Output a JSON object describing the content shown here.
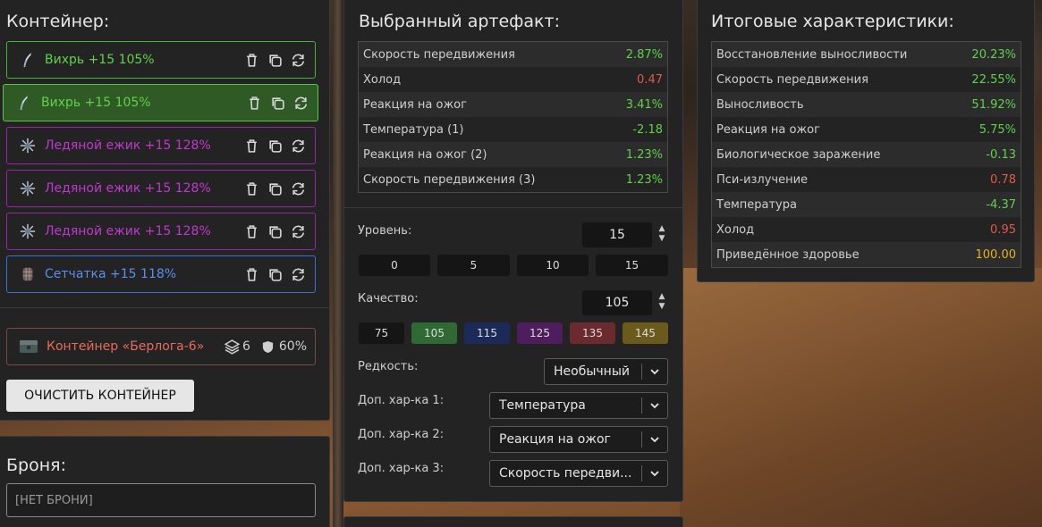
{
  "container": {
    "title": "Контейнер:",
    "items": [
      {
        "name": "Вихрь +15 105%",
        "icon": "feather-icon",
        "color": "green"
      },
      {
        "name": "Вихрь +15 105%",
        "icon": "feather-icon",
        "color": "green-selected"
      },
      {
        "name": "Ледяной ежик +15 128%",
        "icon": "ice-crystal-icon",
        "color": "purple"
      },
      {
        "name": "Ледяной ежик +15 128%",
        "icon": "ice-crystal-icon",
        "color": "purple"
      },
      {
        "name": "Ледяной ежик +15 128%",
        "icon": "ice-crystal-icon",
        "color": "purple"
      },
      {
        "name": "Сетчатка +15 118%",
        "icon": "mesh-artifact-icon",
        "color": "blue"
      }
    ],
    "box": {
      "name": "Контейнер «Берлога-6»",
      "slots": "6",
      "protection": "60%"
    },
    "clear_label": "ОЧИСТИТЬ КОНТЕЙНЕР"
  },
  "armor": {
    "title": "Броня:",
    "value": "[НЕТ БРОНИ]"
  },
  "artifact": {
    "title": "Выбранный артефакт:",
    "stats": [
      {
        "label": "Скорость передвижения",
        "value": "2.87%",
        "color": "#5fd24a"
      },
      {
        "label": "Холод",
        "value": "0.47",
        "color": "#e05a4a"
      },
      {
        "label": "Реакция на ожог",
        "value": "3.41%",
        "color": "#5fd24a"
      },
      {
        "label": "Температура (1)",
        "value": "-2.18",
        "color": "#5fd24a"
      },
      {
        "label": "Реакция на ожог (2)",
        "value": "1.23%",
        "color": "#5fd24a"
      },
      {
        "label": "Скорость передвижения (3)",
        "value": "1.23%",
        "color": "#5fd24a"
      }
    ],
    "level": {
      "label": "Уровень:",
      "value": "15",
      "presets": [
        "0",
        "5",
        "10",
        "15"
      ]
    },
    "quality": {
      "label": "Качество:",
      "value": "105",
      "presets": [
        "75",
        "105",
        "115",
        "125",
        "135",
        "145"
      ]
    },
    "rarity": {
      "label": "Редкость:",
      "value": "Необычный"
    },
    "extra1": {
      "label": "Доп. хар-ка 1:",
      "value": "Температура"
    },
    "extra2": {
      "label": "Доп. хар-ка 2:",
      "value": "Реакция на ожог"
    },
    "extra3": {
      "label": "Доп. хар-ка 3:",
      "value": "Скорость передви..."
    }
  },
  "totals": {
    "title": "Итоговые характеристики:",
    "stats": [
      {
        "label": "Восстановление выносливости",
        "value": "20.23%",
        "color": "#5fd24a"
      },
      {
        "label": "Скорость передвижения",
        "value": "22.55%",
        "color": "#5fd24a"
      },
      {
        "label": "Выносливость",
        "value": "51.92%",
        "color": "#5fd24a"
      },
      {
        "label": "Реакция на ожог",
        "value": "5.75%",
        "color": "#5fd24a"
      },
      {
        "label": "Биологическое заражение",
        "value": "-0.13",
        "color": "#5fd24a"
      },
      {
        "label": "Пси-излучение",
        "value": "0.78",
        "color": "#e05a4a"
      },
      {
        "label": "Температура",
        "value": "-4.37",
        "color": "#5fd24a"
      },
      {
        "label": "Холод",
        "value": "0.95",
        "color": "#e05a4a"
      },
      {
        "label": "Приведённое здоровье",
        "value": "100.00",
        "color": "#e8b020"
      }
    ]
  }
}
